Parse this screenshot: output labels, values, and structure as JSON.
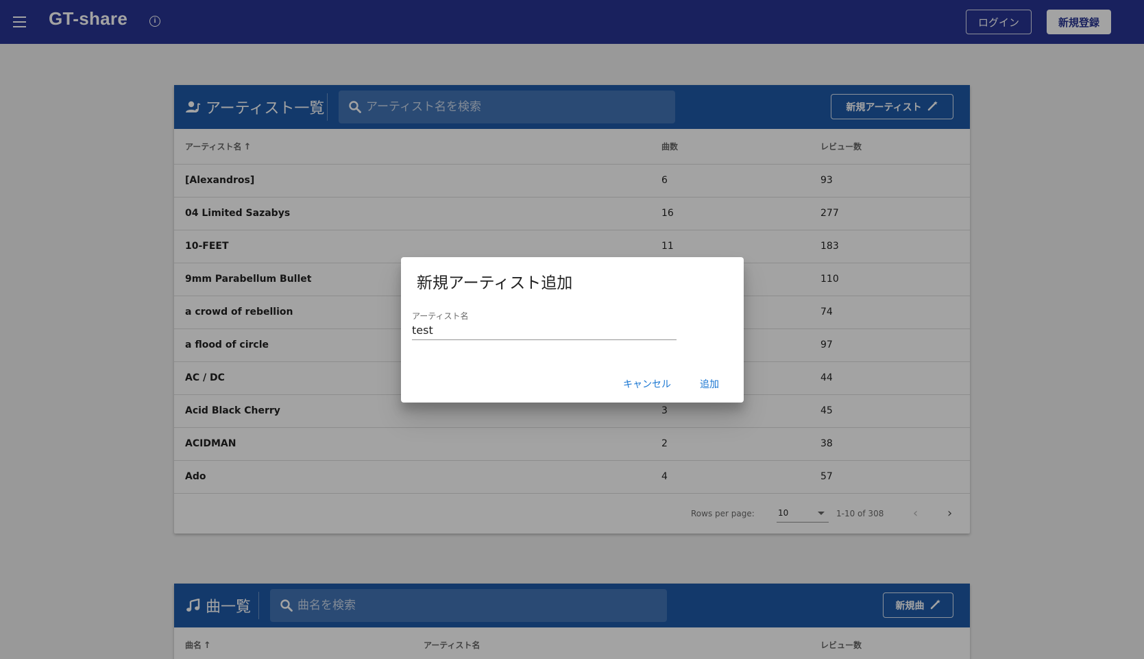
{
  "app": {
    "title": "GT-share",
    "login_label": "ログイン",
    "signup_label": "新規登録",
    "menu_icon": "menu-icon",
    "info_icon": "info-icon"
  },
  "artists_card": {
    "title": "アーティスト一覧",
    "icon": "account-music-icon",
    "search_placeholder": "アーティスト名を検索",
    "new_button_label": "新規アーティスト",
    "new_button_icon": "magic-wand-icon",
    "columns": {
      "name": "アーティスト名",
      "songs": "曲数",
      "reviews": "レビュー数"
    },
    "rows": [
      {
        "name": "[Alexandros]",
        "songs": "6",
        "reviews": "93"
      },
      {
        "name": "04 Limited Sazabys",
        "songs": "16",
        "reviews": "277"
      },
      {
        "name": "10-FEET",
        "songs": "11",
        "reviews": "183"
      },
      {
        "name": "9mm Parabellum Bullet",
        "songs": "",
        "reviews": "110"
      },
      {
        "name": "a crowd of rebellion",
        "songs": "",
        "reviews": "74"
      },
      {
        "name": "a flood of circle",
        "songs": "",
        "reviews": "97"
      },
      {
        "name": "AC / DC",
        "songs": "",
        "reviews": "44"
      },
      {
        "name": "Acid Black Cherry",
        "songs": "3",
        "reviews": "45"
      },
      {
        "name": "ACIDMAN",
        "songs": "2",
        "reviews": "38"
      },
      {
        "name": "Ado",
        "songs": "4",
        "reviews": "57"
      }
    ],
    "footer": {
      "rows_per_page_label": "Rows per page:",
      "rows_per_page_value": "10",
      "range": "1-10 of 308"
    }
  },
  "songs_card": {
    "title": "曲一覧",
    "icon": "music-note-icon",
    "search_placeholder": "曲名を検索",
    "new_button_label": "新規曲",
    "new_button_icon": "magic-wand-icon",
    "columns": {
      "name": "曲名",
      "artist": "アーティスト名",
      "reviews": "レビュー数"
    }
  },
  "dialog": {
    "title": "新規アーティスト追加",
    "field_label": "アーティスト名",
    "field_value": "test",
    "cancel_label": "キャンセル",
    "add_label": "追加"
  },
  "colors": {
    "appbar": "#283593",
    "card_header": "#1e5aa8",
    "accent": "#1976d2"
  }
}
